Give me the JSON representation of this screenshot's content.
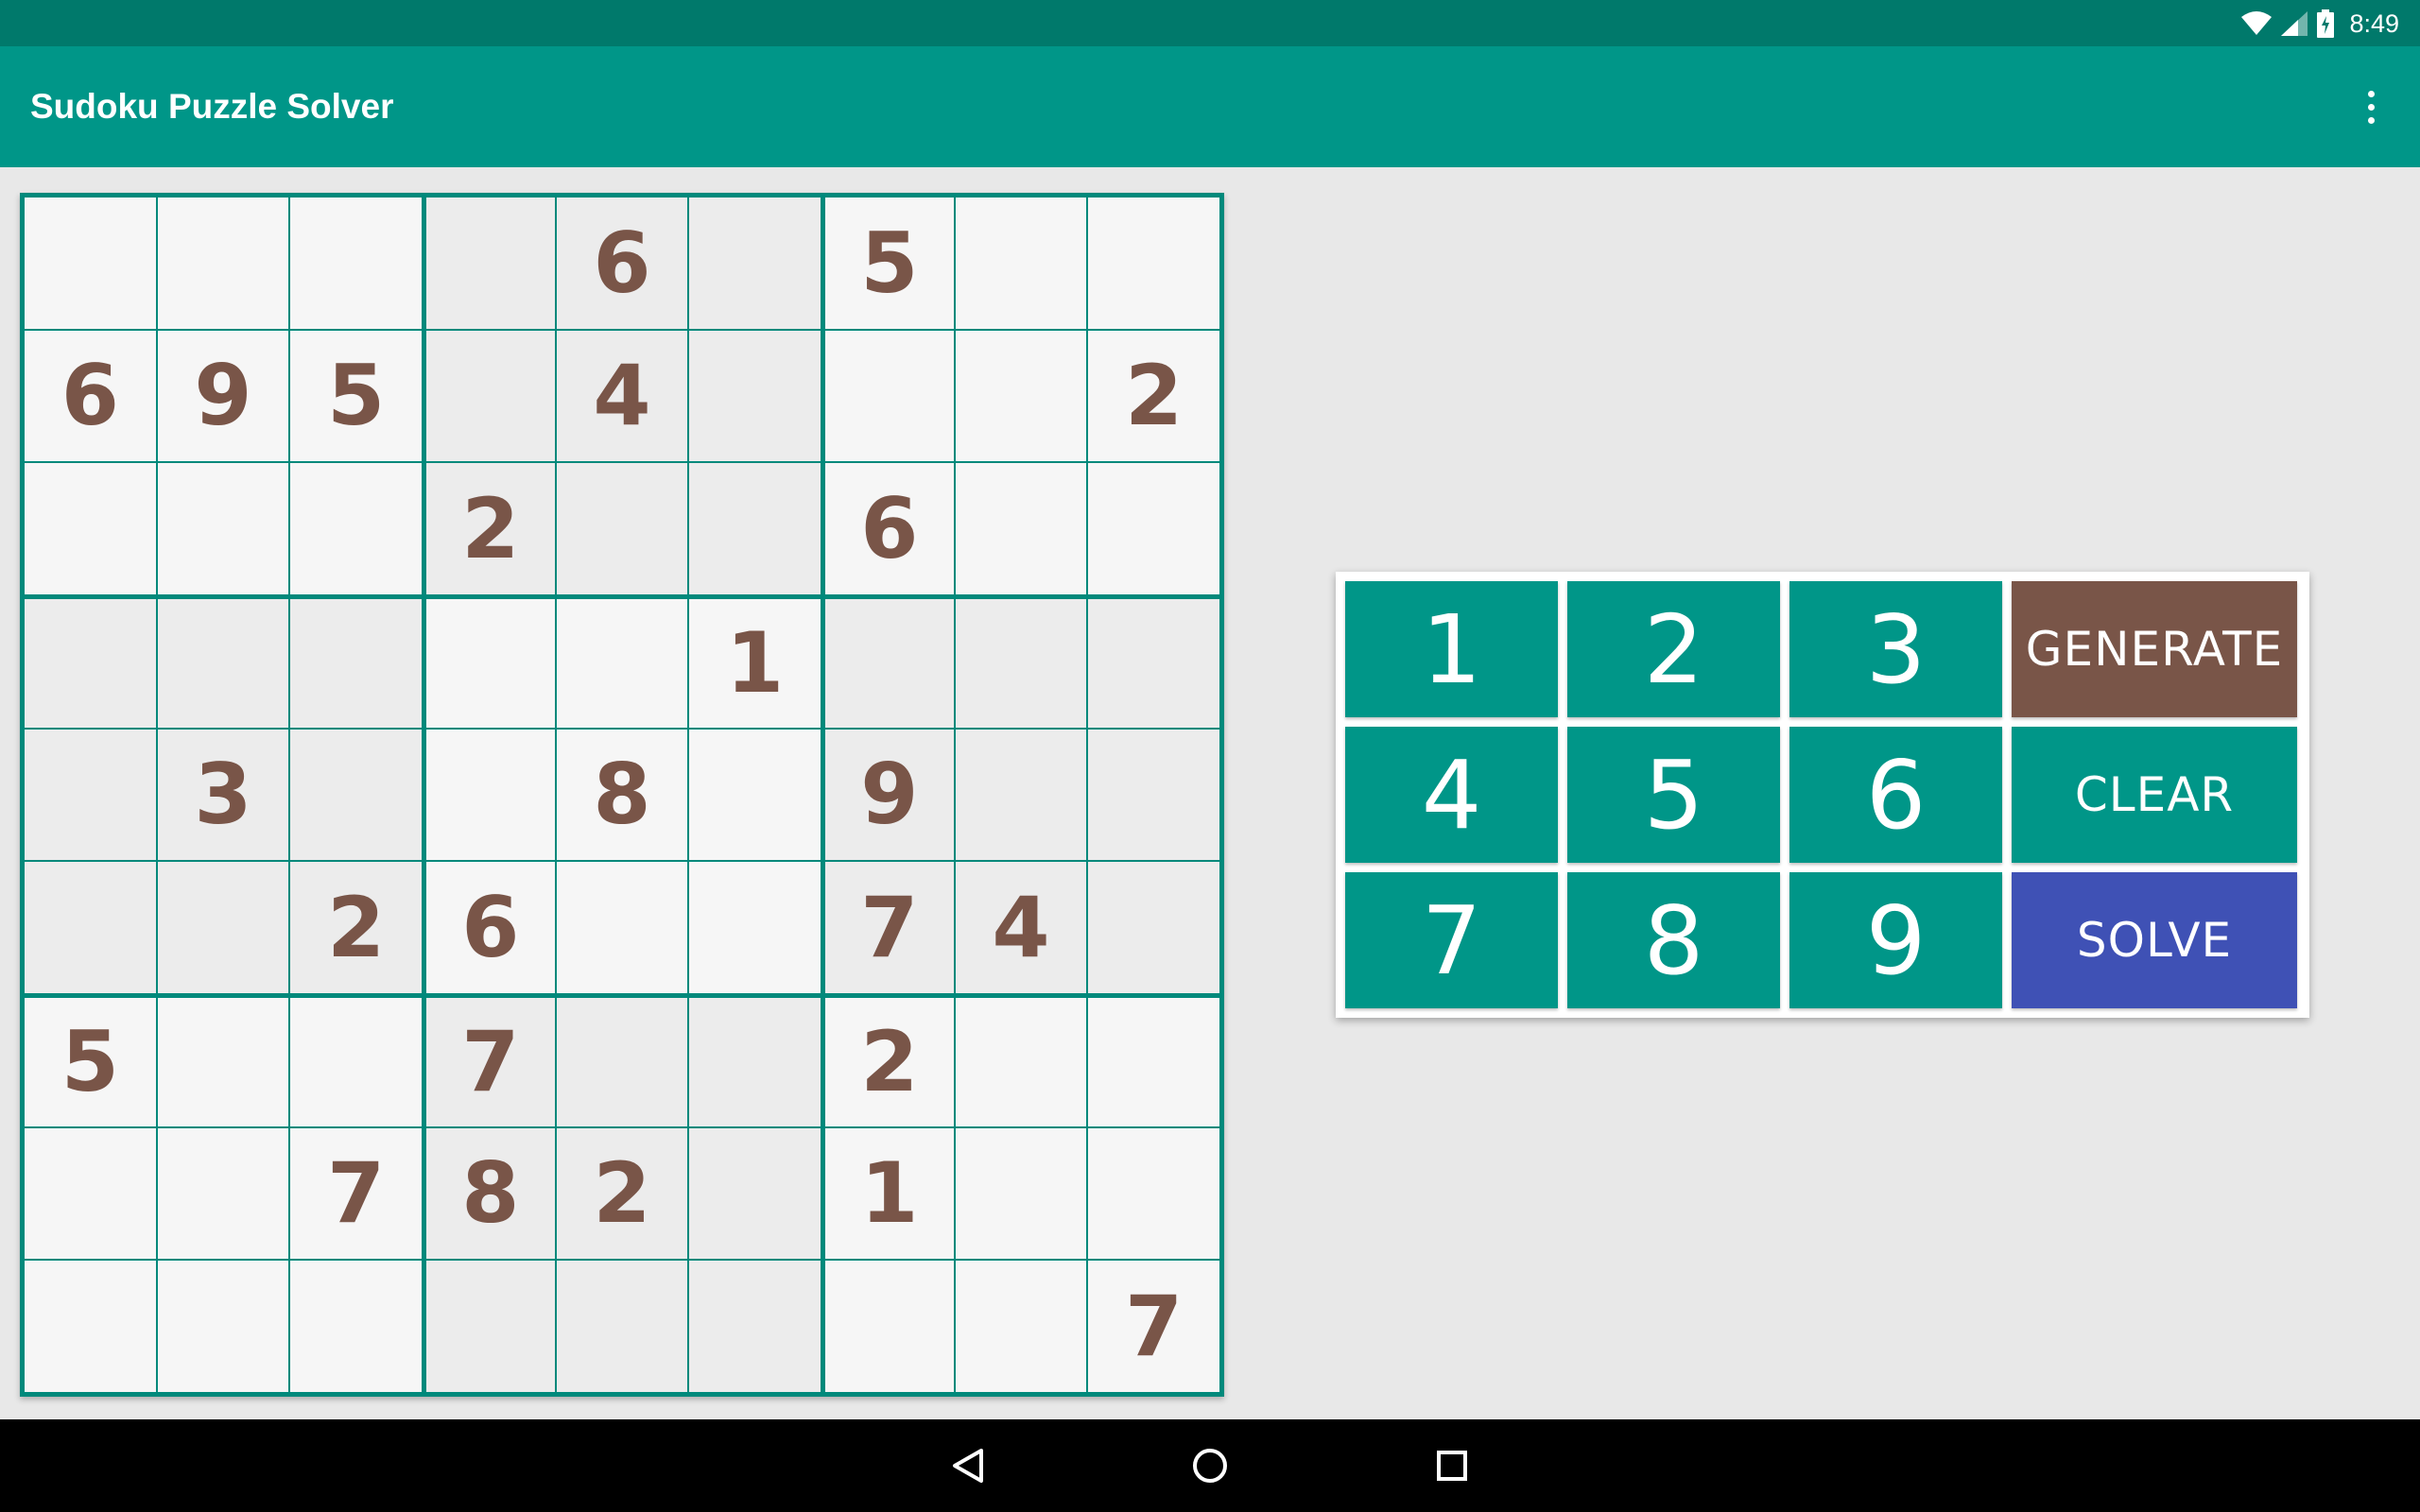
{
  "status_bar": {
    "time": "8:49",
    "icons": [
      "wifi-icon",
      "cell-signal-icon",
      "battery-charging-icon"
    ]
  },
  "app_bar": {
    "title": "Sudoku Puzzle Solver",
    "menu_icon": "more-vert-icon"
  },
  "colors": {
    "primary": "#009688",
    "primary_dark": "#00796b",
    "digit": "#795548",
    "generate": "#795548",
    "solve": "#3f51b5"
  },
  "board": {
    "rows": [
      [
        "",
        "",
        "",
        "",
        "6",
        "",
        "5",
        "",
        ""
      ],
      [
        "6",
        "9",
        "5",
        "",
        "4",
        "",
        "",
        "",
        "2"
      ],
      [
        "",
        "",
        "",
        "2",
        "",
        "",
        "6",
        "",
        ""
      ],
      [
        "",
        "",
        "",
        "",
        "",
        "1",
        "",
        "",
        ""
      ],
      [
        "",
        "3",
        "",
        "",
        "8",
        "",
        "9",
        "",
        ""
      ],
      [
        "",
        "",
        "2",
        "6",
        "",
        "",
        "7",
        "4",
        ""
      ],
      [
        "5",
        "",
        "",
        "7",
        "",
        "",
        "2",
        "",
        ""
      ],
      [
        "",
        "",
        "7",
        "8",
        "2",
        "",
        "1",
        "",
        ""
      ],
      [
        "",
        "",
        "",
        "",
        "",
        "",
        "",
        "",
        "7"
      ]
    ]
  },
  "keypad": {
    "digits": [
      "1",
      "2",
      "3",
      "4",
      "5",
      "6",
      "7",
      "8",
      "9"
    ],
    "generate_label": "GENERATE",
    "clear_label": "CLEAR",
    "solve_label": "SOLVE"
  },
  "nav_bar": {
    "icons": [
      "back-icon",
      "home-icon",
      "recents-icon"
    ]
  }
}
